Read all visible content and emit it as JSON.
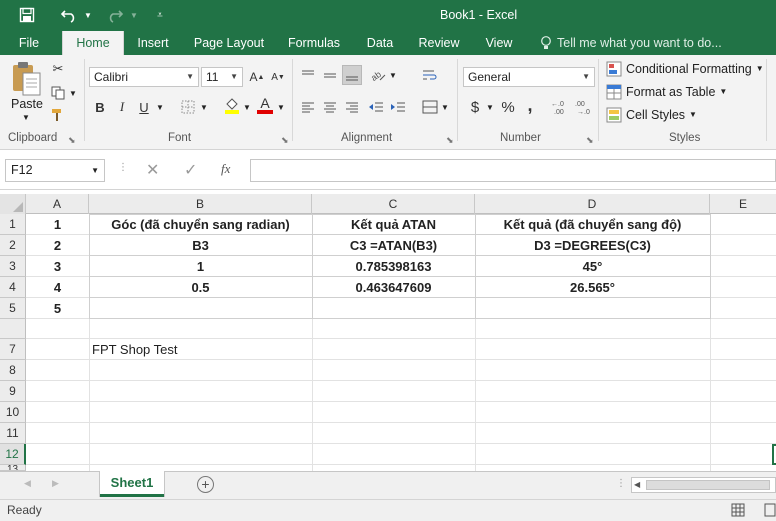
{
  "app": {
    "title": "Book1 - Excel"
  },
  "tabs": [
    "File",
    "Home",
    "Insert",
    "Page Layout",
    "Formulas",
    "Data",
    "Review",
    "View"
  ],
  "tell_me": "Tell me what you want to do...",
  "ribbon": {
    "clipboard": {
      "paste_label": "Paste",
      "group_label": "Clipboard"
    },
    "font": {
      "family": "Calibri",
      "size": "11",
      "group_label": "Font",
      "bold": "B",
      "italic": "I",
      "underline": "U"
    },
    "alignment": {
      "group_label": "Alignment"
    },
    "number": {
      "format": "General",
      "group_label": "Number",
      "currency": "$",
      "percent": "%",
      "comma": ","
    },
    "styles": {
      "conditional_formatting": "Conditional Formatting",
      "format_as_table": "Format as Table",
      "cell_styles": "Cell Styles",
      "group_label": "Styles"
    }
  },
  "formula_bar": {
    "name_box": "F12",
    "fx": "fx",
    "content": ""
  },
  "columns": [
    "A",
    "B",
    "C",
    "D",
    "E"
  ],
  "rows": [
    "1",
    "2",
    "3",
    "4",
    "5",
    "7",
    "8",
    "9",
    "10",
    "11",
    "12",
    "13"
  ],
  "cells": {
    "A1": "1",
    "B1": "Góc (đã chuyển sang radian)",
    "C1": "Kết quả ATAN",
    "D1": "Kết quả (đã chuyển sang độ)",
    "A2": "2",
    "B2": "B3",
    "C2": "C3 =ATAN(B3)",
    "D2": "D3 =DEGREES(C3)",
    "A3": "3",
    "B3": "1",
    "C3": "0.785398163",
    "D3": "45°",
    "A4": "4",
    "B4": "0.5",
    "C4": "0.463647609",
    "D4": "26.565°",
    "A5": "5",
    "B7": "FPT Shop Test"
  },
  "sheets": [
    "Sheet1"
  ],
  "status": {
    "text": "Ready"
  },
  "colors": {
    "accent": "#217346"
  }
}
